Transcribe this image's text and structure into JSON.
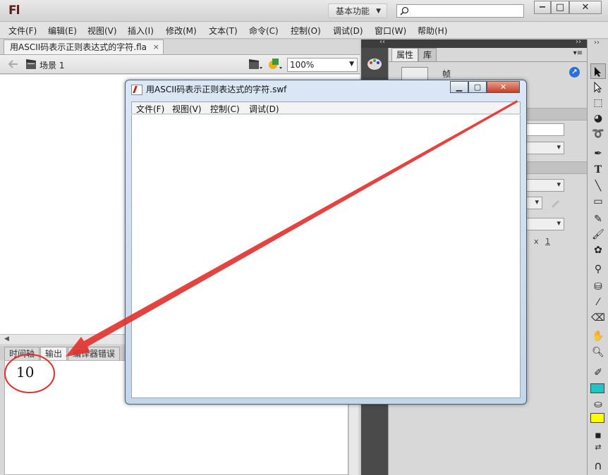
{
  "app": {
    "logo": "Fl",
    "workspace": "基本功能",
    "search_placeholder": ""
  },
  "window_controls": {
    "minimize": "−",
    "maximize": "□",
    "close": "✕"
  },
  "menubar": [
    "文件(F)",
    "编辑(E)",
    "视图(V)",
    "插入(I)",
    "修改(M)",
    "文本(T)",
    "命令(C)",
    "控制(O)",
    "调试(D)",
    "窗口(W)",
    "帮助(H)"
  ],
  "document": {
    "tab_title": "用ASCII码表示正则表达式的字符.fla",
    "tab_close": "×",
    "scene_label": "场景 1",
    "zoom": "100%"
  },
  "bottom_tabs": [
    "时间轴",
    "输出",
    "编译器错误"
  ],
  "output": {
    "value": "10"
  },
  "properties_panel": {
    "tabs": [
      "属性",
      "库"
    ],
    "frame_label": "帧",
    "x_label": "x",
    "x_value": "1"
  },
  "swf_window": {
    "title": "用ASCII码表示正则表达式的字符.swf",
    "menu": [
      "文件(F)",
      "视图(V)",
      "控制(C)",
      "调试(D)"
    ]
  },
  "annotation": {
    "color": "#e0302a",
    "circle_target": "output-value"
  },
  "colors": {
    "fill_swatch": "#1fc6c6",
    "stroke_swatch": "#ffff00"
  }
}
